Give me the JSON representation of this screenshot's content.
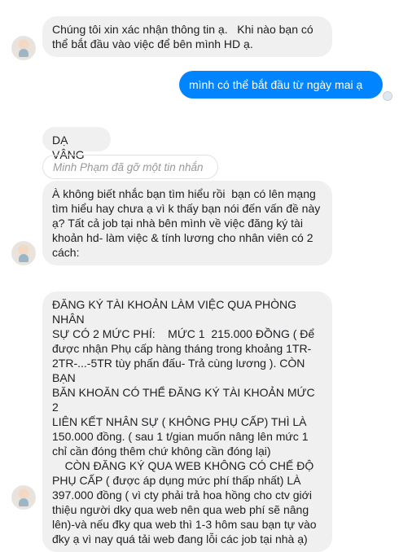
{
  "conversation": {
    "messages": [
      {
        "id": "m1",
        "direction": "in",
        "text": "Chúng tôi xin xác nhận thông tin ạ.   Khi nào bạn có\nthể bắt đầu vào việc để bên mình HD ạ."
      },
      {
        "id": "m2",
        "direction": "out",
        "text": "mình có thể bắt đầu từ ngày mai ạ"
      },
      {
        "id": "m3",
        "direction": "in",
        "text": "DẠ VÂNG"
      },
      {
        "id": "m4",
        "direction": "removed",
        "text": "Minh Phạm đã gỡ một tin nhắn"
      },
      {
        "id": "m5",
        "direction": "in",
        "text": "À không biết nhắc bạn tìm hiểu rồi  bạn có lên mạng\ntìm hiểu hay chưa ạ vì k thấy bạn nói đến vấn đề này\nạ? Tất cả job tại nhà bên mình về việc đăng ký tài\nkhoản hd- làm việc & tính lương cho nhân viên có 2\ncách:"
      },
      {
        "id": "m6",
        "direction": "in",
        "text": "ĐĂNG KÝ TÀI KHOẢN LÀM VIỆC QUA PHÒNG NHÂN\nSỰ CÓ 2 MỨC PHÍ:    MỨC 1  215.000 ĐỒNG ( Để\nđược nhận Phụ cấp hàng tháng trong khoảng 1TR-\n2TR-...-5TR tùy phấn đấu- Trả cùng lương ). CÒN BẠN\nBĂN KHOĂN CÓ THỂ ĐĂNG KÝ TÀI KHOẢN MỨC 2\nLIÊN KẾT NHÂN SỰ ( KHÔNG PHỤ CẤP) THÌ LÀ\n150.000 đồng. ( sau 1 t/gian muốn nâng lên mức 1\nchỉ cần đóng thêm chứ không cần đóng lại)\n    CÒN ĐĂNG KÝ QUA WEB KHÔNG CÓ CHẾ ĐỘ\nPHỤ CẤP ( được áp dụng mức phí thấp nhất) LÀ\n397.000 đồng ( vì cty phải trả hoa hồng cho ctv giới\nthiệu người dky qua web nên qua web phí sẽ nâng\nlên)-và nếu đky qua web thì 1-3 hôm sau bạn tự vào\nđky ạ vì nay quá tải web đang lỗi các job tại nhà ạ)"
      }
    ],
    "avatar_icon": "contact-avatar",
    "colors": {
      "outgoing": "#0084ff",
      "incoming": "#f1f0f0"
    }
  }
}
